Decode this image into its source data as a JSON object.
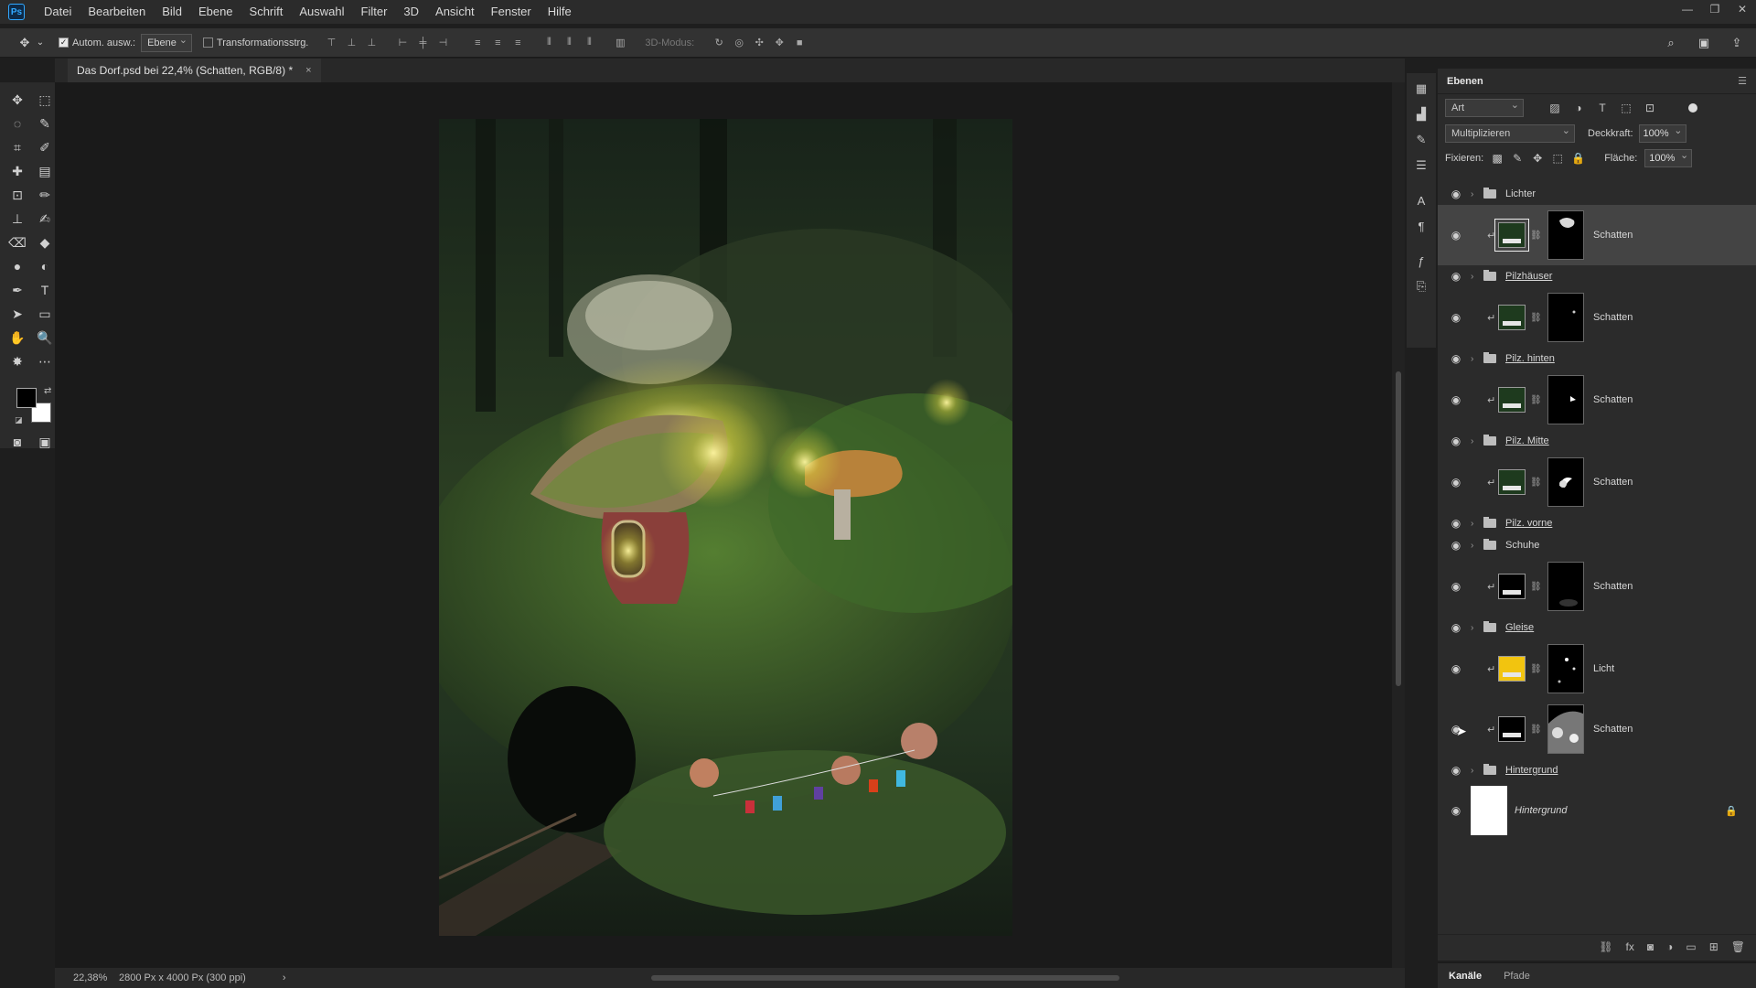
{
  "app": {
    "logo": "Ps"
  },
  "menu": [
    "Datei",
    "Bearbeiten",
    "Bild",
    "Ebene",
    "Schrift",
    "Auswahl",
    "Filter",
    "3D",
    "Ansicht",
    "Fenster",
    "Hilfe"
  ],
  "window_controls": {
    "minimize_icon": "minimize-icon",
    "restore_icon": "restore-icon",
    "close_icon": "close-icon"
  },
  "options": {
    "auto_select_label": "Autom. ausw.:",
    "auto_select_checked": true,
    "auto_select_target": "Ebene",
    "transform_label": "Transformationsstrg.",
    "transform_checked": false,
    "mode_3d_label": "3D-Modus:"
  },
  "document": {
    "tab_title": "Das Dorf.psd bei 22,4% (Schatten, RGB/8) *",
    "close_glyph": "×"
  },
  "status": {
    "zoom": "22,38%",
    "doc_size": "2800 Px x 4000 Px (300 ppi)"
  },
  "layers_panel": {
    "title": "Ebenen",
    "filter_kind": "Art",
    "blend_mode": "Multiplizieren",
    "opacity_label": "Deckkraft:",
    "opacity_value": "100%",
    "lock_label": "Fixieren:",
    "fill_label": "Fläche:",
    "fill_value": "100%",
    "layers": [
      {
        "type": "group",
        "name": "Lichter",
        "underline": false
      },
      {
        "type": "item",
        "name": "Schatten",
        "color": "#1e3a1e",
        "selected": true,
        "mask": "mask-1"
      },
      {
        "type": "group",
        "name": "Pilzhäuser",
        "underline": true
      },
      {
        "type": "item",
        "name": "Schatten",
        "color": "#1e3a1e",
        "selected": false,
        "mask": "mask-2"
      },
      {
        "type": "group",
        "name": "Pilz. hinten",
        "underline": true
      },
      {
        "type": "item",
        "name": "Schatten",
        "color": "#1e3a1e",
        "selected": false,
        "mask": "mask-3"
      },
      {
        "type": "group",
        "name": "Pilz. Mitte",
        "underline": true
      },
      {
        "type": "item",
        "name": "Schatten",
        "color": "#1e3a1e",
        "selected": false,
        "mask": "mask-4"
      },
      {
        "type": "group",
        "name": "Pilz. vorne",
        "underline": true
      },
      {
        "type": "group",
        "name": "Schuhe",
        "underline": false
      },
      {
        "type": "item",
        "name": "Schatten",
        "color": "#000000",
        "selected": false,
        "mask": "mask-5"
      },
      {
        "type": "group",
        "name": "Gleise",
        "underline": true
      },
      {
        "type": "item",
        "name": "Licht",
        "color": "#f2c40f",
        "selected": false,
        "mask": "mask-6"
      },
      {
        "type": "item",
        "name": "Schatten",
        "color": "#000000",
        "selected": false,
        "mask": "mask-7"
      },
      {
        "type": "group",
        "name": "Hintergrund",
        "underline": true
      }
    ],
    "background_layer": {
      "name": "Hintergrund",
      "locked": true
    }
  },
  "bottom_tabs": [
    "Kanäle",
    "Pfade"
  ],
  "colors": {
    "accent": "#31a8ff",
    "panel": "#2b2b2b",
    "canvas": "#1a1a1a",
    "foreground": "#000000",
    "background": "#ffffff"
  }
}
